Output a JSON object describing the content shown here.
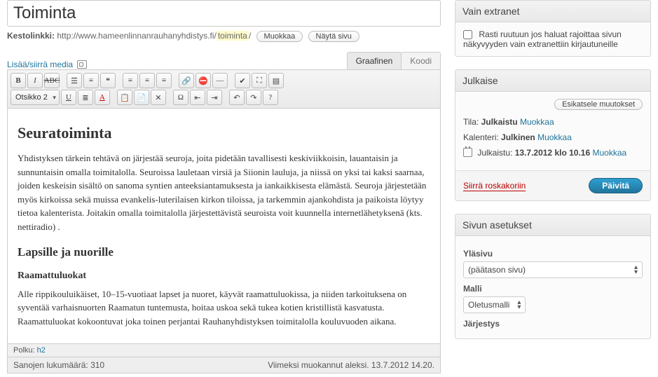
{
  "title": "Toiminta",
  "permalink": {
    "label": "Kestolinkki:",
    "base": "http://www.hameenlinnanrauhanyhdistys.fi/",
    "slug": "toiminta",
    "tail": "/",
    "edit": "Muokkaa",
    "view": "Näytä sivu"
  },
  "media": {
    "label": "Lisää/siirrä media"
  },
  "tabs": {
    "visual": "Graafinen",
    "text": "Koodi"
  },
  "format_select": "Otsikko 2",
  "content": {
    "h2": "Seuratoiminta",
    "p1": "Yhdistyksen tärkein tehtävä on järjestää seuroja, joita pidetään tavallisesti keskiviikkoisin, lauantaisin ja sunnuntaisin omalla toimitalolla. Seuroissa lauletaan virsiä ja Siionin lauluja, ja niissä on yksi tai kaksi saarnaa, joiden keskeisin sisältö on sanoma syntien anteeksiantamuksesta ja iankaikkisesta elämästä. Seuroja järjestetään myös kirkoissa sekä muissa evankelis-luterilaisen kirkon tiloissa, ja tarkemmin ajankohdista ja paikoista löytyy tietoa kalenterista. Joitakin omalla toimitalolla järjestettävistä seuroista voit kuunnella internetlähetyksenä (kts. nettiradio) .",
    "h3": "Lapsille ja nuorille",
    "h4": "Raamattuluokat",
    "p2": "Alle rippikouluikäiset, 10–15-vuotiaat lapset ja nuoret, käyvät raamattuluokissa, ja niiden tarkoituksena on syventää varhaisnuorten Raamatun tuntemusta, hoitaa uskoa sekä tukea kotien kristillistä kasvatusta. Raamattuluokat kokoontuvat joka toinen perjantai Rauhanyhdistyksen toimitalolla kouluvuoden aikana."
  },
  "path": {
    "label": "Polku:",
    "value": "h2"
  },
  "status": {
    "words_label": "Sanojen lukumäärä:",
    "words": "310",
    "last_edit": "Viimeksi muokannut aleksi. 13.7.2012 14.20."
  },
  "extranet": {
    "title": "Vain extranet",
    "checkbox": "Rasti ruutuun jos haluat rajoittaa sivun näkyvyyden vain extranettiin kirjautuneille"
  },
  "publish": {
    "title": "Julkaise",
    "preview": "Esikatsele muutokset",
    "status_label": "Tila:",
    "status_value": "Julkaistu",
    "visibility_label": "Kalenteri:",
    "visibility_value": "Julkinen",
    "published_label": "Julkaistu:",
    "published_value": "13.7.2012 klo 10.16",
    "edit": "Muokkaa",
    "trash": "Siirrä roskakoriin",
    "update": "Päivitä"
  },
  "attrs": {
    "title": "Sivun asetukset",
    "parent_label": "Yläsivu",
    "parent_value": "(päätason sivu)",
    "template_label": "Malli",
    "template_value": "Oletusmalli",
    "order_label": "Järjestys"
  }
}
